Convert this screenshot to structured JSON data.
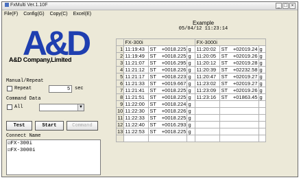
{
  "window": {
    "title": "FxMulti Ver.1.10F",
    "controls": [
      "_",
      "□",
      "×"
    ]
  },
  "menu": [
    "File(F)",
    "Config(G)",
    "Copy(C)",
    "Excel(E)"
  ],
  "logo": {
    "text": "A&D",
    "company": "A&D Company,Limited"
  },
  "manual": {
    "label": "Manual/Repeat",
    "repeat_label": "Repeat",
    "repeat_value": "5",
    "unit": "sec"
  },
  "command": {
    "label": "Command Data",
    "all_label": "All",
    "selected": ""
  },
  "buttons": {
    "test": "Test",
    "start": "Start",
    "command": "Command"
  },
  "connect": {
    "label": "Connect Name",
    "items": [
      {
        "name": "FX-300i",
        "checked": true
      },
      {
        "name": "FX-3000i",
        "checked": true
      }
    ]
  },
  "sheet": {
    "title": "Example",
    "datetime": "05/04/12 11:23:14",
    "col_a": "FX-300i",
    "col_b": "FX-3000i",
    "rows": [
      {
        "n": "1",
        "t1": "11:19:43",
        "s1": "ST",
        "v1": "+0018.225",
        "u1": "g",
        "t2": "11:20:02",
        "s2": "ST",
        "v2": "+02019.24",
        "u2": "g"
      },
      {
        "n": "2",
        "t1": "11:19:49",
        "s1": "ST",
        "v1": "+0018.225",
        "u1": "g",
        "t2": "11:20:05",
        "s2": "ST",
        "v2": "+02019.26",
        "u2": "g"
      },
      {
        "n": "3",
        "t1": "11:21:07",
        "s1": "ST",
        "v1": "+0016.295",
        "u1": "g",
        "t2": "11:20:12",
        "s2": "ST",
        "v2": "+02019.28",
        "u2": "g"
      },
      {
        "n": "4",
        "t1": "11:21:12",
        "s1": "ST",
        "v1": "+0018.226",
        "u1": "g",
        "t2": "11:20:39",
        "s2": "ST",
        "v2": "+02232.58",
        "u2": "g"
      },
      {
        "n": "5",
        "t1": "11:21:17",
        "s1": "ST",
        "v1": "+0018.223",
        "u1": "g",
        "t2": "11:20:47",
        "s2": "ST",
        "v2": "+02019.27",
        "u2": "g"
      },
      {
        "n": "6",
        "t1": "11:21:33",
        "s1": "ST",
        "v1": "+0019.667",
        "u1": "g",
        "t2": "11:23:02",
        "s2": "ST",
        "v2": "+02019.27",
        "u2": "g"
      },
      {
        "n": "7",
        "t1": "11:21:41",
        "s1": "ST",
        "v1": "+0018.225",
        "u1": "g",
        "t2": "11:23:09",
        "s2": "ST",
        "v2": "+02019.26",
        "u2": "g"
      },
      {
        "n": "8",
        "t1": "11:21:51",
        "s1": "ST",
        "v1": "+0018.225",
        "u1": "g",
        "t2": "11:23:16",
        "s2": "ST",
        "v2": "+01863.45",
        "u2": "g"
      },
      {
        "n": "9",
        "t1": "11:22:00",
        "s1": "ST",
        "v1": "+0018.224",
        "u1": "g",
        "t2": "",
        "s2": "",
        "v2": "",
        "u2": ""
      },
      {
        "n": "10",
        "t1": "11:22:30",
        "s1": "ST",
        "v1": "+0018.226",
        "u1": "g",
        "t2": "",
        "s2": "",
        "v2": "",
        "u2": ""
      },
      {
        "n": "11",
        "t1": "11:22:33",
        "s1": "ST",
        "v1": "+0018.225",
        "u1": "g",
        "t2": "",
        "s2": "",
        "v2": "",
        "u2": ""
      },
      {
        "n": "12",
        "t1": "11:22:40",
        "s1": "ST",
        "v1": "+0016.293",
        "u1": "g",
        "t2": "",
        "s2": "",
        "v2": "",
        "u2": ""
      },
      {
        "n": "13",
        "t1": "11:22:53",
        "s1": "ST",
        "v1": "+0018.225",
        "u1": "g",
        "t2": "",
        "s2": "",
        "v2": "",
        "u2": ""
      }
    ],
    "empty_rows": 1
  },
  "colors": {
    "logo_blue": "#1f3fb0",
    "face": "#ece9d8"
  }
}
